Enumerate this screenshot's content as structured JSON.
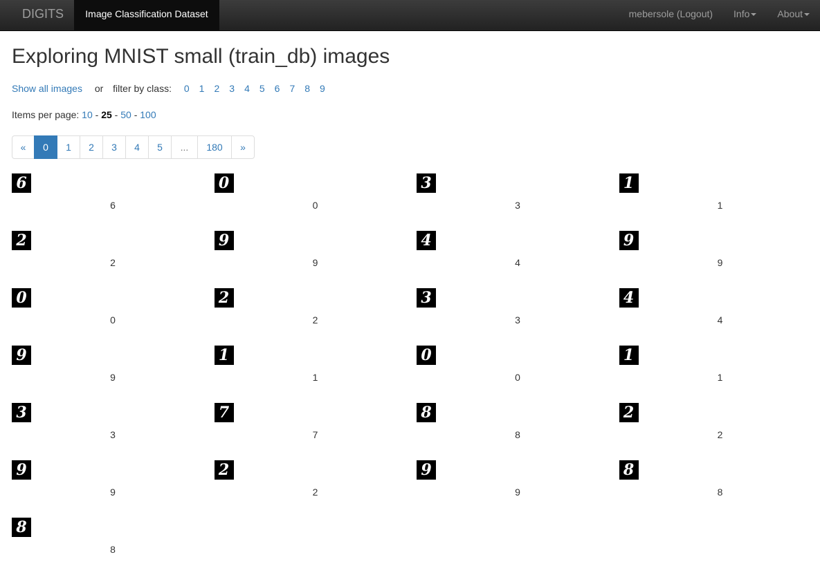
{
  "navbar": {
    "brand": "DIGITS",
    "active_tab": "Image Classification Dataset",
    "user_link": "mebersole (Logout)",
    "info_menu": "Info",
    "about_menu": "About"
  },
  "page": {
    "title": "Exploring MNIST small (train_db) images"
  },
  "filter": {
    "show_all": "Show all images",
    "or_text": "or",
    "filter_label": "filter by class:",
    "classes": [
      "0",
      "1",
      "2",
      "3",
      "4",
      "5",
      "6",
      "7",
      "8",
      "9"
    ]
  },
  "per_page": {
    "label": "Items per page:",
    "options": [
      "10",
      "25",
      "50",
      "100"
    ],
    "selected": "25",
    "separator": "-"
  },
  "pagination": {
    "prev": "«",
    "next": "»",
    "pages": [
      "0",
      "1",
      "2",
      "3",
      "4",
      "5",
      "...",
      "180"
    ],
    "active": "0"
  },
  "images": [
    {
      "digit": "6",
      "label": "6"
    },
    {
      "digit": "0",
      "label": "0"
    },
    {
      "digit": "3",
      "label": "3"
    },
    {
      "digit": "1",
      "label": "1"
    },
    {
      "digit": "2",
      "label": "2"
    },
    {
      "digit": "9",
      "label": "9"
    },
    {
      "digit": "4",
      "label": "4"
    },
    {
      "digit": "9",
      "label": "9"
    },
    {
      "digit": "0",
      "label": "0"
    },
    {
      "digit": "2",
      "label": "2"
    },
    {
      "digit": "3",
      "label": "3"
    },
    {
      "digit": "4",
      "label": "4"
    },
    {
      "digit": "9",
      "label": "9"
    },
    {
      "digit": "1",
      "label": "1"
    },
    {
      "digit": "0",
      "label": "0"
    },
    {
      "digit": "1",
      "label": "1"
    },
    {
      "digit": "3",
      "label": "3"
    },
    {
      "digit": "7",
      "label": "7"
    },
    {
      "digit": "8",
      "label": "8"
    },
    {
      "digit": "2",
      "label": "2"
    },
    {
      "digit": "9",
      "label": "9"
    },
    {
      "digit": "2",
      "label": "2"
    },
    {
      "digit": "9",
      "label": "9"
    },
    {
      "digit": "8",
      "label": "8"
    },
    {
      "digit": "8",
      "label": "8"
    }
  ]
}
